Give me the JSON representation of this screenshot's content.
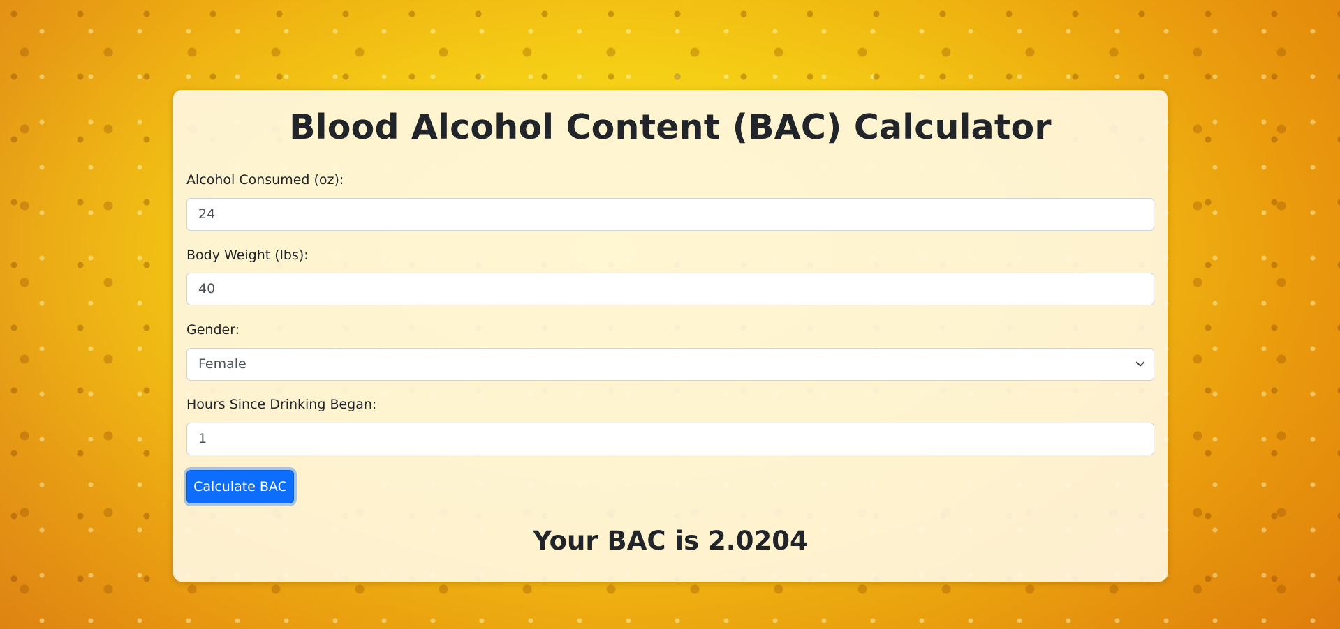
{
  "page": {
    "title": "Blood Alcohol Content (BAC) Calculator"
  },
  "form": {
    "alcohol": {
      "label": "Alcohol Consumed (oz):",
      "value": "24"
    },
    "weight": {
      "label": "Body Weight (lbs):",
      "value": "40"
    },
    "gender": {
      "label": "Gender:",
      "selected": "Female"
    },
    "hours": {
      "label": "Hours Since Drinking Began:",
      "value": "1"
    },
    "submit_label": "Calculate BAC"
  },
  "result": {
    "text": "Your BAC is 2.0204"
  },
  "colors": {
    "primary": "#0d6efd",
    "text": "#212529",
    "card_bg": "#fff8e4"
  },
  "icons": {
    "select_arrow": "chevron-down-icon"
  }
}
